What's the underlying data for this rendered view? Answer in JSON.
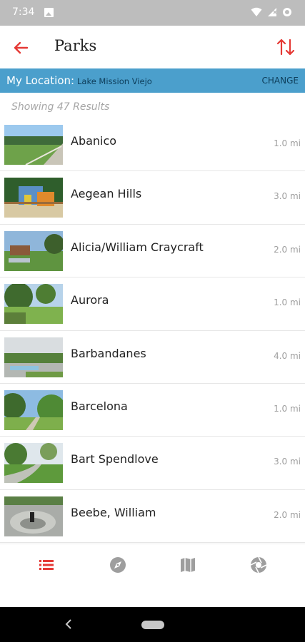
{
  "status_bar": {
    "time": "7:34"
  },
  "app_bar": {
    "title": "Parks",
    "accent": "#e53935"
  },
  "location": {
    "label": "My Location:",
    "value": "Lake Mission Viejo",
    "change_label": "CHANGE",
    "bar_color": "#4b9fcc"
  },
  "results": {
    "text": "Showing 47 Results"
  },
  "parks": [
    {
      "name": "Abanico",
      "distance": "1.0 mi"
    },
    {
      "name": "Aegean Hills",
      "distance": "3.0 mi"
    },
    {
      "name": "Alicia/William Craycraft",
      "distance": "2.0 mi"
    },
    {
      "name": "Aurora",
      "distance": "1.0 mi"
    },
    {
      "name": "Barbandanes",
      "distance": "4.0 mi"
    },
    {
      "name": "Barcelona",
      "distance": "1.0 mi"
    },
    {
      "name": "Bart Spendlove",
      "distance": "3.0 mi"
    },
    {
      "name": "Beebe, William",
      "distance": "2.0 mi"
    }
  ],
  "bottom_nav": {
    "active": "list",
    "items": [
      "list-icon",
      "compass-icon",
      "map-icon",
      "aperture-icon"
    ]
  }
}
